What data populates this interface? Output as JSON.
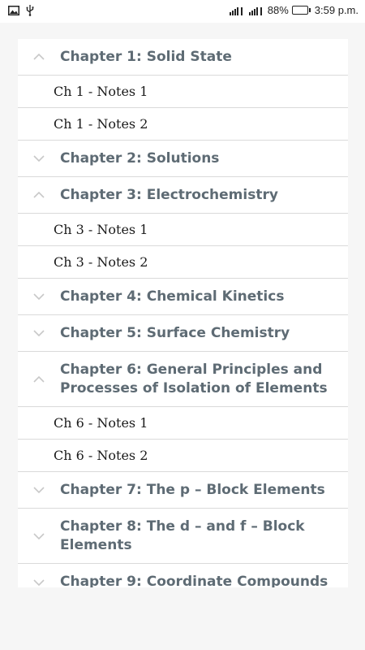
{
  "status_bar": {
    "battery_percent": "88%",
    "time": "3:59 p.m.",
    "left_icons": [
      "image-icon",
      "usb-icon"
    ],
    "battery_color": "#32c832"
  },
  "chapters": [
    {
      "title": "Chapter 1: Solid State",
      "expanded": true,
      "notes": [
        "Ch 1 - Notes 1",
        "Ch 1 - Notes 2"
      ]
    },
    {
      "title": "Chapter 2: Solutions",
      "expanded": false,
      "notes": []
    },
    {
      "title": "Chapter 3: Electrochemistry",
      "expanded": true,
      "notes": [
        "Ch 3 - Notes 1",
        "Ch 3 - Notes 2"
      ]
    },
    {
      "title": "Chapter 4: Chemical Kinetics",
      "expanded": false,
      "notes": []
    },
    {
      "title": "Chapter 5: Surface Chemistry",
      "expanded": false,
      "notes": []
    },
    {
      "title": "Chapter 6: General Principles and Processes of Isolation of Elements",
      "expanded": true,
      "notes": [
        "Ch 6 - Notes 1",
        "Ch 6 - Notes 2"
      ]
    },
    {
      "title": "Chapter 7: The p – Block Elements",
      "expanded": false,
      "notes": []
    },
    {
      "title": "Chapter 8: The d – and f – Block Elements",
      "expanded": false,
      "notes": []
    },
    {
      "title": "Chapter 9: Coordinate Compounds",
      "expanded": false,
      "notes": []
    }
  ],
  "colors": {
    "chapter_text": "#5e6b74",
    "note_text": "#1b1b1b",
    "chevron": "#c8c8c8",
    "divider": "#dadada",
    "background": "#f6f6f6"
  }
}
